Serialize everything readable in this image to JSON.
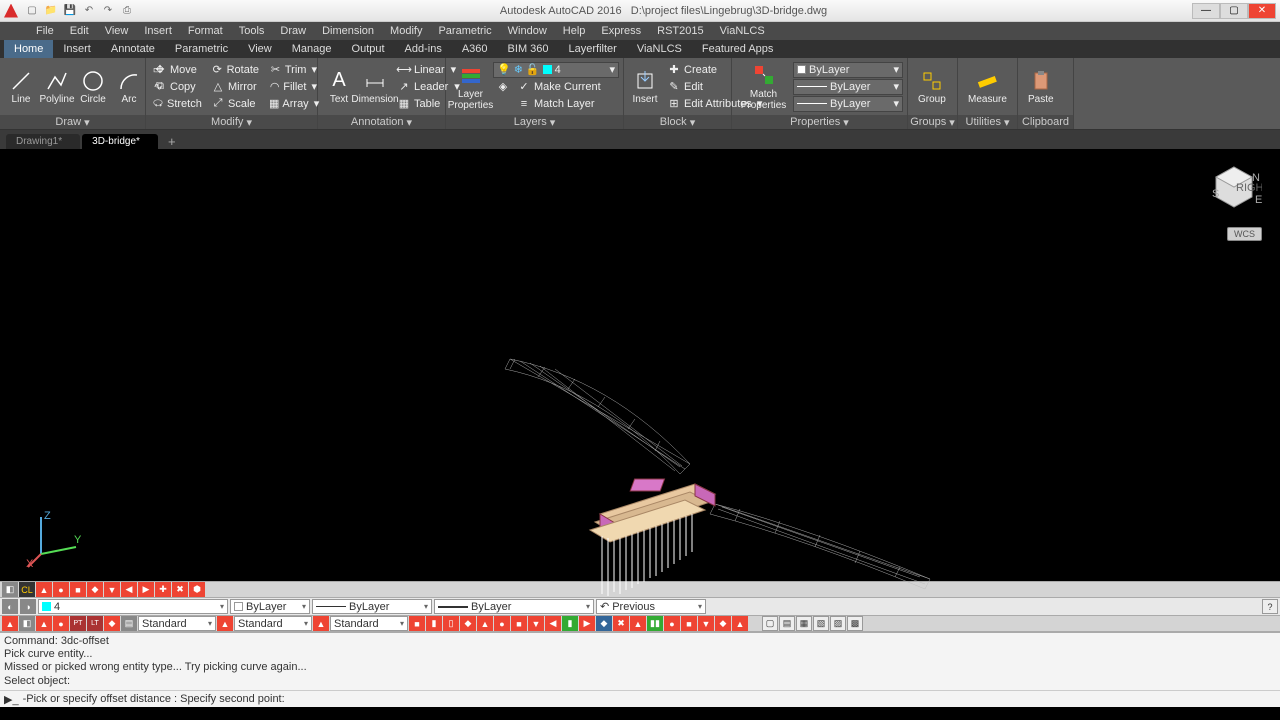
{
  "title": {
    "app": "Autodesk AutoCAD 2016",
    "file": "D:\\project files\\Lingebrug\\3D-bridge.dwg"
  },
  "menus": [
    "File",
    "Edit",
    "View",
    "Insert",
    "Format",
    "Tools",
    "Draw",
    "Dimension",
    "Modify",
    "Parametric",
    "Window",
    "Help",
    "Express",
    "RST2015",
    "ViaNLCS"
  ],
  "ribbonTabs": [
    "Home",
    "Insert",
    "Annotate",
    "Parametric",
    "View",
    "Manage",
    "Output",
    "Add-ins",
    "A360",
    "BIM 360",
    "Layerfilter",
    "ViaNLCS",
    "Featured Apps"
  ],
  "activeRibbonTab": 0,
  "panels": {
    "draw": {
      "label": "Draw",
      "items": [
        "Line",
        "Polyline",
        "Circle",
        "Arc"
      ]
    },
    "modify": {
      "label": "Modify",
      "rows": [
        [
          "Move",
          "Rotate",
          "Trim"
        ],
        [
          "Copy",
          "Mirror",
          "Fillet"
        ],
        [
          "Stretch",
          "Scale",
          "Array"
        ]
      ]
    },
    "annotation": {
      "label": "Annotation",
      "big": [
        "Text",
        "Dimension"
      ],
      "rows": [
        "Linear",
        "Leader",
        "Table"
      ]
    },
    "layers": {
      "label": "Layers",
      "big": "Layer Properties",
      "current": "4",
      "rows": [
        "Make Current",
        "Match Layer"
      ]
    },
    "block": {
      "label": "Block",
      "big": "Insert",
      "rows": [
        "Create",
        "Edit",
        "Edit Attributes"
      ]
    },
    "properties": {
      "label": "Properties",
      "big": "Match Properties",
      "rows": [
        "ByLayer",
        "ByLayer",
        "ByLayer"
      ]
    },
    "groups": {
      "label": "Groups",
      "big": "Group"
    },
    "utilities": {
      "label": "Utilities",
      "big": "Measure"
    },
    "clipboard": {
      "label": "Clipboard",
      "big": "Paste"
    }
  },
  "docTabs": [
    "Drawing1*",
    "3D-bridge*"
  ],
  "activeDocTab": 1,
  "propBar": {
    "layer": "4",
    "color": "ByLayer",
    "ltype": "ByLayer",
    "lweight": "ByLayer",
    "undo": "Previous"
  },
  "stdCombos": [
    "Standard",
    "Standard",
    "Standard"
  ],
  "cmd": {
    "lines": [
      "Command: 3dc-offset",
      "Pick curve entity...",
      "Missed or picked wrong entity type... Try picking curve again...",
      "Select object:"
    ],
    "prompt": "-Pick or specify offset distance :  Specify second point:"
  },
  "wcsLabel": "WCS"
}
